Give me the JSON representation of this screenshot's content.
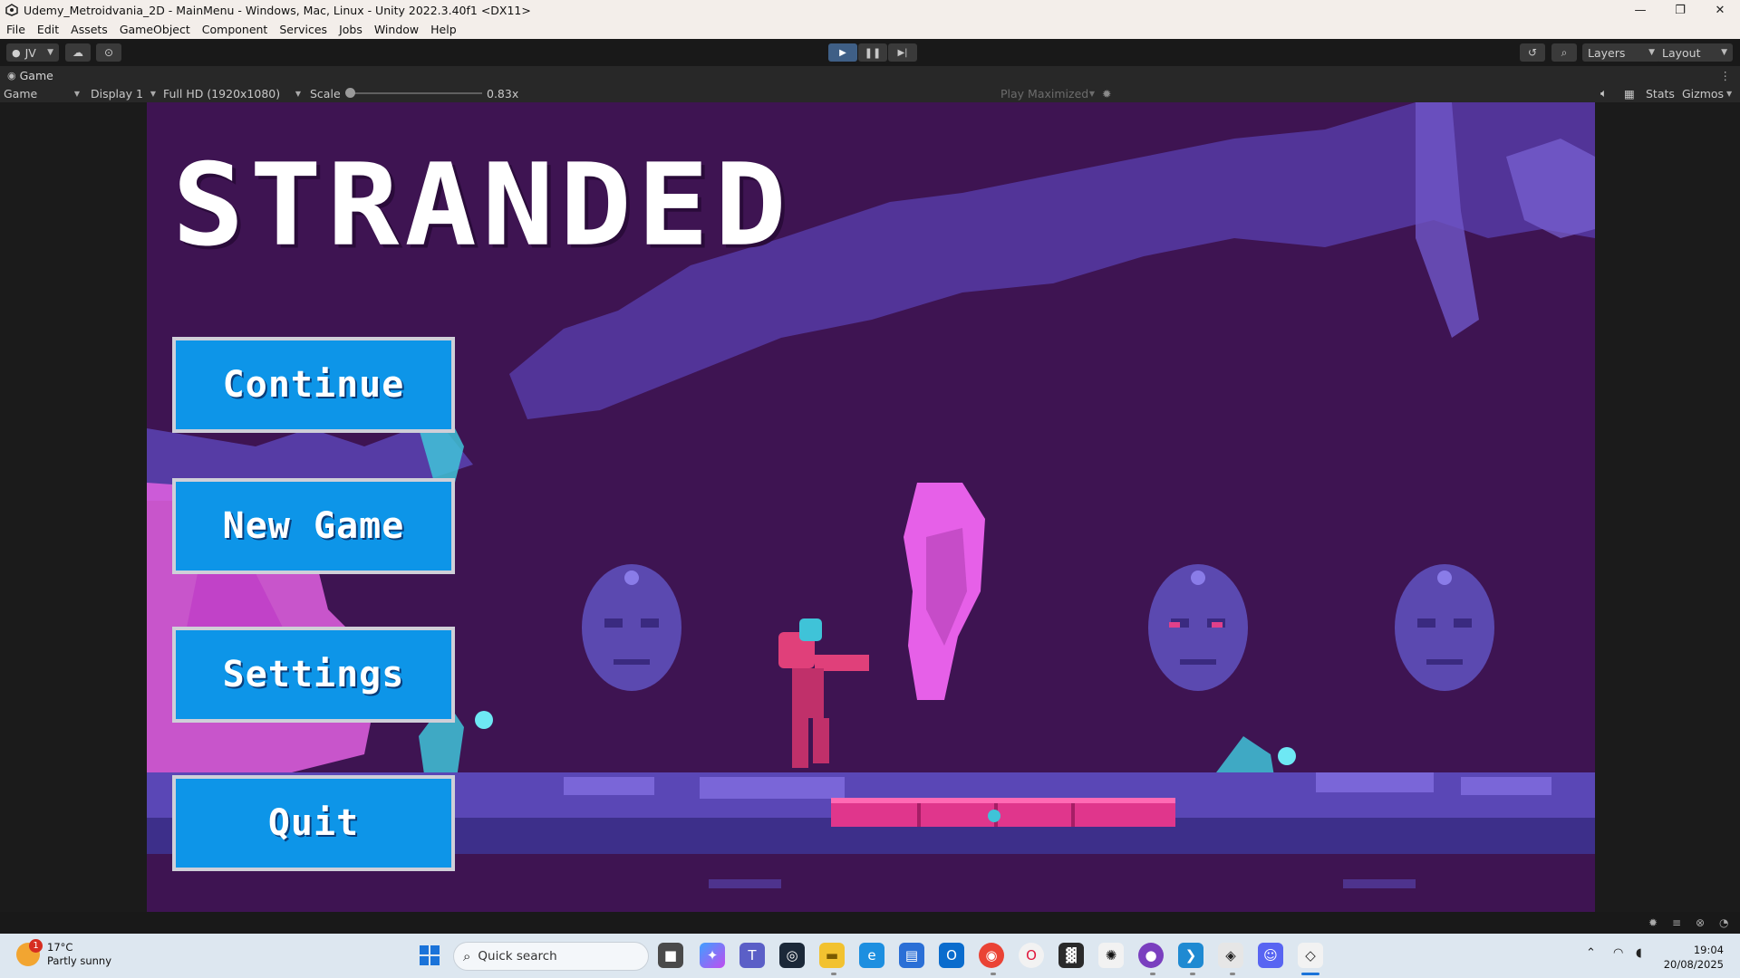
{
  "window": {
    "title": "Udemy_Metroidvania_2D - MainMenu - Windows, Mac, Linux - Unity 2022.3.40f1 <DX11>",
    "minimize": "—",
    "restore": "❐",
    "close": "✕"
  },
  "menu": [
    "File",
    "Edit",
    "Assets",
    "GameObject",
    "Component",
    "Services",
    "Jobs",
    "Window",
    "Help"
  ],
  "toolbar": {
    "account": "JV",
    "layers": "Layers",
    "layout": "Layout"
  },
  "game_tab": {
    "label": "Game"
  },
  "game_controls": {
    "mode": "Game",
    "display": "Display 1",
    "resolution": "Full HD (1920x1080)",
    "scale_label": "Scale",
    "scale_value": "0.83x",
    "play_mode": "Play Maximized",
    "stats": "Stats",
    "gizmos": "Gizmos"
  },
  "game": {
    "title": "STRANDED",
    "buttons": {
      "continue": "Continue",
      "new_game": "New Game",
      "settings": "Settings",
      "quit": "Quit"
    }
  },
  "taskbar": {
    "weather_temp": "17°C",
    "weather_desc": "Partly sunny",
    "weather_badge": "1",
    "search_placeholder": "Quick search",
    "time": "19:04",
    "date": "20/08/2025"
  },
  "colors": {
    "button_bg": "#0d95e8",
    "game_bg": "#3e1452",
    "editor_bg": "#191919",
    "play_active": "#3f5f86"
  }
}
